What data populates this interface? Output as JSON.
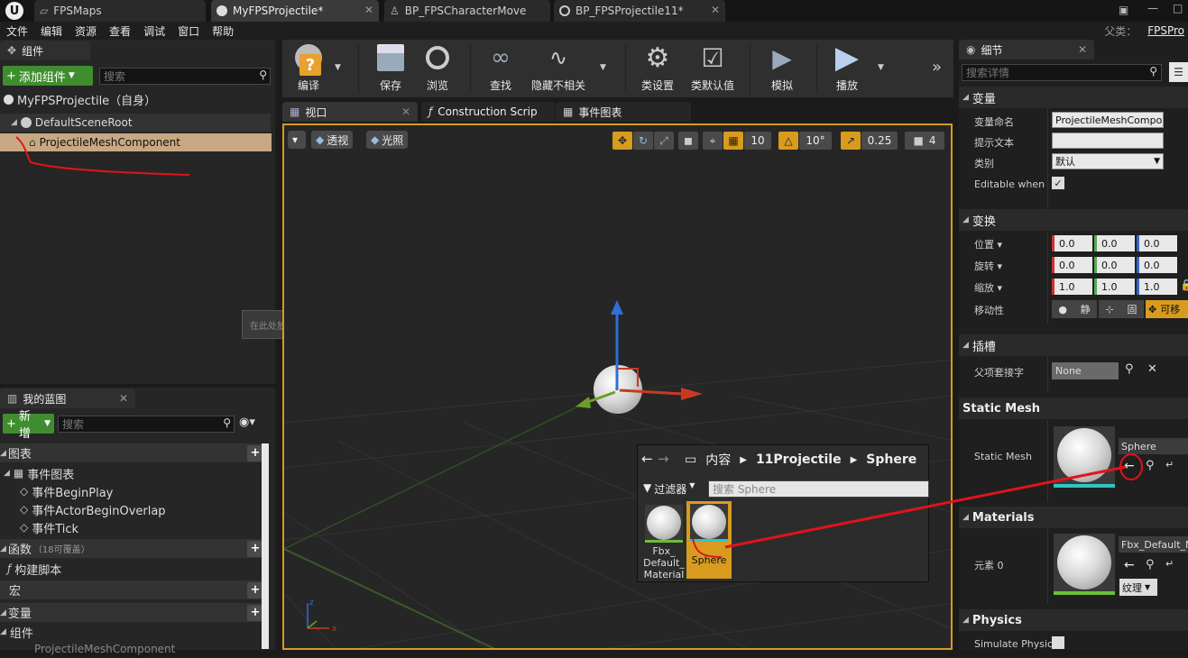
{
  "titlebar": {
    "tabs": [
      {
        "label": "FPSMaps"
      },
      {
        "label": "MyFPSProjectile*"
      },
      {
        "label": "BP_FPSCharacterMove"
      },
      {
        "label": "BP_FPSProjectile11*"
      }
    ]
  },
  "menu": [
    "文件",
    "编辑",
    "资源",
    "查看",
    "调试",
    "窗口",
    "帮助"
  ],
  "parent": {
    "label": "父类：",
    "value": "FPSPro"
  },
  "components_panel": {
    "tab": "组件",
    "add_button": "添加组件",
    "search_placeholder": "搜索",
    "self_item": "MyFPSProjectile（自身）",
    "items": [
      "DefaultSceneRoot",
      "ProjectileMeshComponent"
    ],
    "drop_hint": "在此处放置资源添加组件。"
  },
  "blueprint_panel": {
    "tab": "我的蓝图",
    "new_button": "新增",
    "search_placeholder": "搜索",
    "sections": {
      "graphs": "图表",
      "event_graph": "事件图表",
      "events": [
        "事件BeginPlay",
        "事件ActorBeginOverlap",
        "事件Tick"
      ],
      "functions": "函数",
      "functions_count": "（18可覆盖）",
      "construction": "构建脚本",
      "macros": "宏",
      "variables": "变量",
      "components": "组件",
      "component_item": "ProjectileMeshComponent"
    }
  },
  "toolbar": {
    "compile": "编译",
    "save": "保存",
    "browse": "浏览",
    "find": "查找",
    "hide": "隐藏不相关",
    "class_settings": "类设置",
    "class_defaults": "类默认值",
    "simulate": "模拟",
    "play": "播放"
  },
  "editor_tabs": [
    "视口",
    "Construction Scrip",
    "事件图表"
  ],
  "viewport": {
    "perspective": "透视",
    "lit": "光照",
    "grid_snap": "10",
    "rot_snap": "10°",
    "scale_snap": "0.25",
    "cam_speed": "4"
  },
  "content_browser": {
    "breadcrumb": [
      "内容",
      "11Projectile",
      "Sphere"
    ],
    "filters": "过滤器",
    "search_placeholder": "搜索 Sphere",
    "assets": [
      {
        "label": "Fbx_ Default_ Material"
      },
      {
        "label": "Sphere"
      }
    ]
  },
  "details": {
    "tab": "细节",
    "search_placeholder": "搜索详情",
    "variable_section": "变量",
    "var_name_label": "变量命名",
    "var_name_value": "ProjectileMeshCompon",
    "tooltip_label": "提示文本",
    "category_label": "类别",
    "category_value": "默认",
    "editable_label": "Editable when In",
    "transform_section": "变换",
    "location_label": "位置",
    "rotation_label": "旋转",
    "scale_label": "缩放",
    "location": [
      "0.0",
      "0.0",
      "0.0"
    ],
    "rotation": [
      "0.0",
      "0.0",
      "0.0"
    ],
    "scale": [
      "1.0",
      "1.0",
      "1.0"
    ],
    "mobility_label": "移动性",
    "mobility": [
      "静",
      "固",
      "可移"
    ],
    "sockets_section": "插槽",
    "parent_socket_label": "父项套接字",
    "parent_socket_value": "None",
    "static_mesh_section": "Static Mesh",
    "static_mesh_label": "Static Mesh",
    "static_mesh_value": "Sphere",
    "materials_section": "Materials",
    "element_label": "元素 0",
    "material_value": "Fbx_Default_M",
    "texture_button": "纹理",
    "physics_section": "Physics",
    "simulate_label": "Simulate Physic"
  },
  "colors": {
    "accent": "#d89b1e",
    "green_button": "#3f8d2f",
    "annotation": "#e0141b",
    "selection": "#c8a883"
  }
}
